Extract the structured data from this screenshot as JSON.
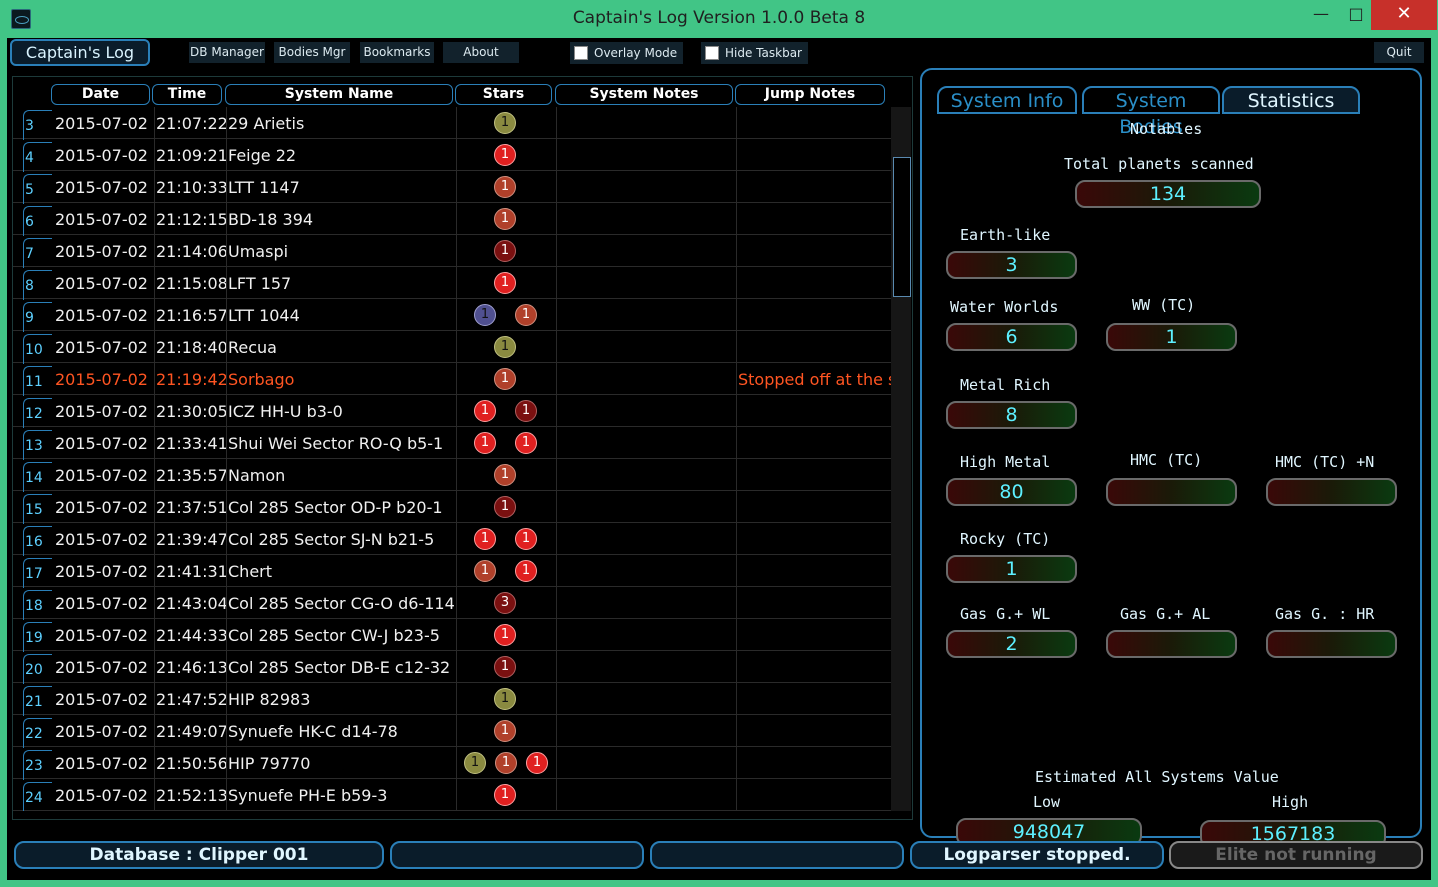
{
  "window": {
    "title": "Captain's Log Version 1.0.0 Beta 8",
    "min": "—",
    "max": "□",
    "close": "✕"
  },
  "menu": {
    "captains_log": "Captain's Log",
    "db_manager": "DB Manager",
    "bodies_mgr": "Bodies Mgr",
    "bookmarks": "Bookmarks",
    "about": "About",
    "overlay_mode": "Overlay Mode",
    "hide_taskbar": "Hide Taskbar",
    "quit": "Quit"
  },
  "grid": {
    "headers": [
      "Date",
      "Time",
      "System Name",
      "Stars",
      "System Notes",
      "Jump Notes"
    ],
    "rows": [
      {
        "n": "3",
        "date": "2015-07-02",
        "time": "21:07:22",
        "name": "29 Arietis",
        "stars": [
          {
            "c": "yellow",
            "v": "1"
          }
        ],
        "sn": "",
        "jn": ""
      },
      {
        "n": "4",
        "date": "2015-07-02",
        "time": "21:09:21",
        "name": "Feige 22",
        "stars": [
          {
            "c": "red",
            "v": "1"
          }
        ],
        "sn": "",
        "jn": ""
      },
      {
        "n": "5",
        "date": "2015-07-02",
        "time": "21:10:33",
        "name": "LTT 1147",
        "stars": [
          {
            "c": "orange",
            "v": "1"
          }
        ],
        "sn": "",
        "jn": ""
      },
      {
        "n": "6",
        "date": "2015-07-02",
        "time": "21:12:15",
        "name": "BD-18 394",
        "stars": [
          {
            "c": "orange",
            "v": "1"
          }
        ],
        "sn": "",
        "jn": ""
      },
      {
        "n": "7",
        "date": "2015-07-02",
        "time": "21:14:06",
        "name": "Umaspi",
        "stars": [
          {
            "c": "dark",
            "v": "1"
          }
        ],
        "sn": "",
        "jn": ""
      },
      {
        "n": "8",
        "date": "2015-07-02",
        "time": "21:15:08",
        "name": "LFT 157",
        "stars": [
          {
            "c": "red",
            "v": "1"
          }
        ],
        "sn": "",
        "jn": ""
      },
      {
        "n": "9",
        "date": "2015-07-02",
        "time": "21:16:57",
        "name": "LTT 1044",
        "stars": [
          {
            "c": "blue",
            "v": "1"
          },
          {
            "c": "orange",
            "v": "1"
          }
        ],
        "sn": "",
        "jn": ""
      },
      {
        "n": "10",
        "date": "2015-07-02",
        "time": "21:18:40",
        "name": "Recua",
        "stars": [
          {
            "c": "yellow",
            "v": "1"
          }
        ],
        "sn": "",
        "jn": ""
      },
      {
        "n": "11",
        "date": "2015-07-02",
        "time": "21:19:42",
        "name": "Sorbago",
        "stars": [
          {
            "c": "orange",
            "v": "1"
          }
        ],
        "sn": "",
        "jn": "Stopped off at the s",
        "hl": true
      },
      {
        "n": "12",
        "date": "2015-07-02",
        "time": "21:30:05",
        "name": "ICZ HH-U b3-0",
        "stars": [
          {
            "c": "red",
            "v": "1"
          },
          {
            "c": "dark",
            "v": "1"
          }
        ],
        "sn": "",
        "jn": ""
      },
      {
        "n": "13",
        "date": "2015-07-02",
        "time": "21:33:41",
        "name": "Shui Wei Sector RO-Q b5-1",
        "stars": [
          {
            "c": "red",
            "v": "1"
          },
          {
            "c": "red",
            "v": "1"
          }
        ],
        "sn": "",
        "jn": ""
      },
      {
        "n": "14",
        "date": "2015-07-02",
        "time": "21:35:57",
        "name": "Namon",
        "stars": [
          {
            "c": "orange",
            "v": "1"
          }
        ],
        "sn": "",
        "jn": ""
      },
      {
        "n": "15",
        "date": "2015-07-02",
        "time": "21:37:51",
        "name": "Col 285 Sector OD-P b20-1",
        "stars": [
          {
            "c": "dark",
            "v": "1"
          }
        ],
        "sn": "",
        "jn": ""
      },
      {
        "n": "16",
        "date": "2015-07-02",
        "time": "21:39:47",
        "name": "Col 285 Sector SJ-N b21-5",
        "stars": [
          {
            "c": "red",
            "v": "1"
          },
          {
            "c": "red",
            "v": "1"
          }
        ],
        "sn": "",
        "jn": ""
      },
      {
        "n": "17",
        "date": "2015-07-02",
        "time": "21:41:31",
        "name": "Chert",
        "stars": [
          {
            "c": "orange",
            "v": "1"
          },
          {
            "c": "red",
            "v": "1"
          }
        ],
        "sn": "",
        "jn": ""
      },
      {
        "n": "18",
        "date": "2015-07-02",
        "time": "21:43:04",
        "name": "Col 285 Sector CG-O d6-114",
        "stars": [
          {
            "c": "dark",
            "v": "3"
          }
        ],
        "sn": "",
        "jn": ""
      },
      {
        "n": "19",
        "date": "2015-07-02",
        "time": "21:44:33",
        "name": "Col 285 Sector CW-J b23-5",
        "stars": [
          {
            "c": "red",
            "v": "1"
          }
        ],
        "sn": "",
        "jn": ""
      },
      {
        "n": "20",
        "date": "2015-07-02",
        "time": "21:46:13",
        "name": "Col 285 Sector DB-E c12-32",
        "stars": [
          {
            "c": "dark",
            "v": "1"
          }
        ],
        "sn": "",
        "jn": ""
      },
      {
        "n": "21",
        "date": "2015-07-02",
        "time": "21:47:52",
        "name": "HIP 82983",
        "stars": [
          {
            "c": "yellow",
            "v": "1"
          }
        ],
        "sn": "",
        "jn": ""
      },
      {
        "n": "22",
        "date": "2015-07-02",
        "time": "21:49:07",
        "name": "Synuefe HK-C d14-78",
        "stars": [
          {
            "c": "orange",
            "v": "1"
          }
        ],
        "sn": "",
        "jn": ""
      },
      {
        "n": "23",
        "date": "2015-07-02",
        "time": "21:50:56",
        "name": "HIP 79770",
        "stars": [
          {
            "c": "yellow",
            "v": "1"
          },
          {
            "c": "orange",
            "v": "1"
          },
          {
            "c": "red",
            "v": "1"
          }
        ],
        "sn": "",
        "jn": ""
      },
      {
        "n": "24",
        "date": "2015-07-02",
        "time": "21:52:13",
        "name": "Synuefe PH-E b59-3",
        "stars": [
          {
            "c": "red",
            "v": "1"
          }
        ],
        "sn": "",
        "jn": ""
      }
    ]
  },
  "tabs": [
    {
      "label": "System Info",
      "active": false
    },
    {
      "label": "System Bodies",
      "active": false
    },
    {
      "label": "Statistics",
      "active": true
    }
  ],
  "stats": {
    "notables": "Notables",
    "total_planets_label": "Total planets scanned",
    "total_planets": "134",
    "earth_like_label": "Earth-like",
    "earth_like": "3",
    "water_worlds_label": "Water Worlds",
    "water_worlds": "6",
    "ww_tc_label": "WW (TC)",
    "ww_tc": "1",
    "metal_rich_label": "Metal Rich",
    "metal_rich": "8",
    "high_metal_label": "High Metal",
    "high_metal": "80",
    "hmc_tc_label": "HMC (TC)",
    "hmc_tc": "",
    "hmc_tc_n_label": "HMC (TC) +N",
    "hmc_tc_n": "",
    "rocky_tc_label": "Rocky (TC)",
    "rocky_tc": "1",
    "gas_wl_label": "Gas G.+ WL",
    "gas_wl": "2",
    "gas_al_label": "Gas G.+ AL",
    "gas_al": "",
    "gas_hr_label": "Gas G. : HR",
    "gas_hr": "",
    "estimated_label": "Estimated All Systems Value",
    "low_label": "Low",
    "low": "948047",
    "high_label": "High",
    "high": "1567183"
  },
  "status": {
    "database": "Database : Clipper 001",
    "blank1": "",
    "blank2": "",
    "logparser": "Logparser stopped.",
    "elite": "Elite not running"
  }
}
